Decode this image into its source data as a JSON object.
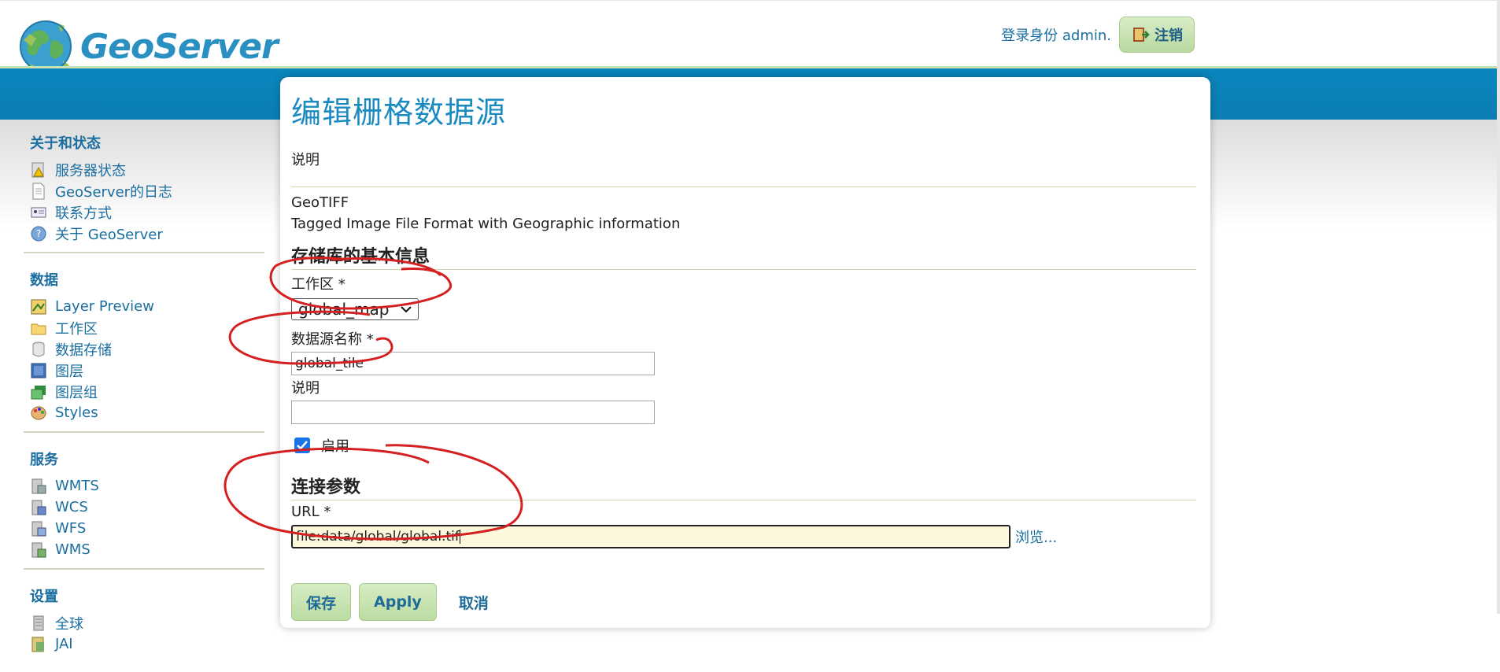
{
  "header": {
    "brand": "GeoServer",
    "login_text": "登录身份 admin.",
    "logout_label": "注销"
  },
  "sidebar": {
    "sections": [
      {
        "title": "关于和状态",
        "items": [
          {
            "label": "服务器状态",
            "icon": "server-status-icon"
          },
          {
            "label": "GeoServer的日志",
            "icon": "log-document-icon"
          },
          {
            "label": "联系方式",
            "icon": "contact-card-icon"
          },
          {
            "label": "关于 GeoServer",
            "icon": "help-icon"
          }
        ]
      },
      {
        "title": "数据",
        "items": [
          {
            "label": "Layer Preview",
            "icon": "layer-preview-icon"
          },
          {
            "label": "工作区",
            "icon": "folder-icon"
          },
          {
            "label": "数据存储",
            "icon": "database-icon"
          },
          {
            "label": "图层",
            "icon": "layer-icon"
          },
          {
            "label": "图层组",
            "icon": "layer-group-icon"
          },
          {
            "label": "Styles",
            "icon": "palette-icon"
          }
        ]
      },
      {
        "title": "服务",
        "items": [
          {
            "label": "WMTS",
            "icon": "service-icon"
          },
          {
            "label": "WCS",
            "icon": "service-icon"
          },
          {
            "label": "WFS",
            "icon": "service-icon"
          },
          {
            "label": "WMS",
            "icon": "service-icon"
          }
        ]
      },
      {
        "title": "设置",
        "items": [
          {
            "label": "全球",
            "icon": "server-icon"
          },
          {
            "label": "JAI",
            "icon": "server-icon"
          }
        ]
      }
    ]
  },
  "main": {
    "title": "编辑栅格数据源",
    "description_label": "说明",
    "format_name": "GeoTIFF",
    "format_description": "Tagged Image File Format with Geographic information",
    "basic_info_heading": "存储库的基本信息",
    "workspace_label": "工作区 *",
    "workspace_value": "global_map",
    "name_label": "数据源名称 *",
    "name_value": "global_tile",
    "desc_field_label": "说明",
    "desc_field_value": "",
    "enabled_label": "启用",
    "enabled": true,
    "connection_heading": "连接参数",
    "url_label": "URL *",
    "url_value": "file:data/global/global.tif",
    "browse_label": "浏览...",
    "save_label": "保存",
    "apply_label": "Apply",
    "cancel_label": "取消"
  },
  "colors": {
    "accent_blue": "#0c7db3",
    "link_blue": "#1a6fa0",
    "button_green": "#bcdca2",
    "annotation_red": "#d42020"
  }
}
